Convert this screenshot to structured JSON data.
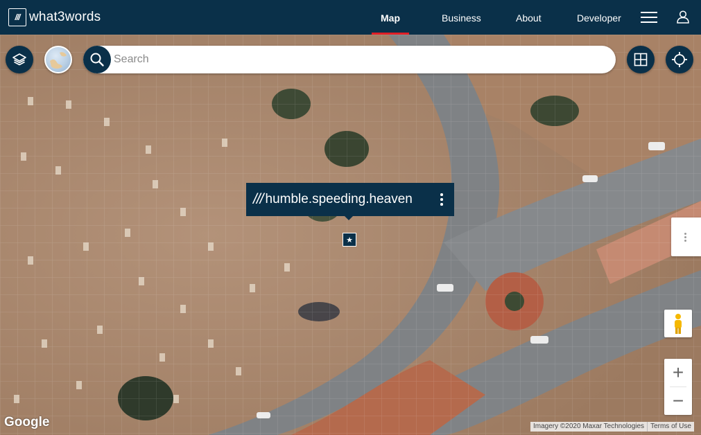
{
  "header": {
    "logo_mark": "///",
    "logo_text": "what3words",
    "nav": [
      {
        "label": "Map",
        "active": true
      },
      {
        "label": "Business",
        "active": false
      },
      {
        "label": "About",
        "active": false
      },
      {
        "label": "Developer",
        "active": false
      }
    ]
  },
  "search": {
    "placeholder": "Search",
    "value": ""
  },
  "location": {
    "slashes": "///",
    "address": "humble.speeding.heaven"
  },
  "map": {
    "provider_logo": "Google",
    "imagery_credit": "Imagery ©2020 Maxar Technologies",
    "terms_label": "Terms of Use",
    "zoom_in_label": "+",
    "zoom_out_label": "−"
  },
  "colors": {
    "brand_navy": "#0a3049",
    "active_underline": "#e11f26"
  },
  "icons": [
    "layers-icon",
    "globe-icon",
    "search-icon",
    "grid-icon",
    "locate-icon",
    "menu-icon",
    "user-icon",
    "more-vertical-icon",
    "pegman-icon",
    "star-icon"
  ]
}
